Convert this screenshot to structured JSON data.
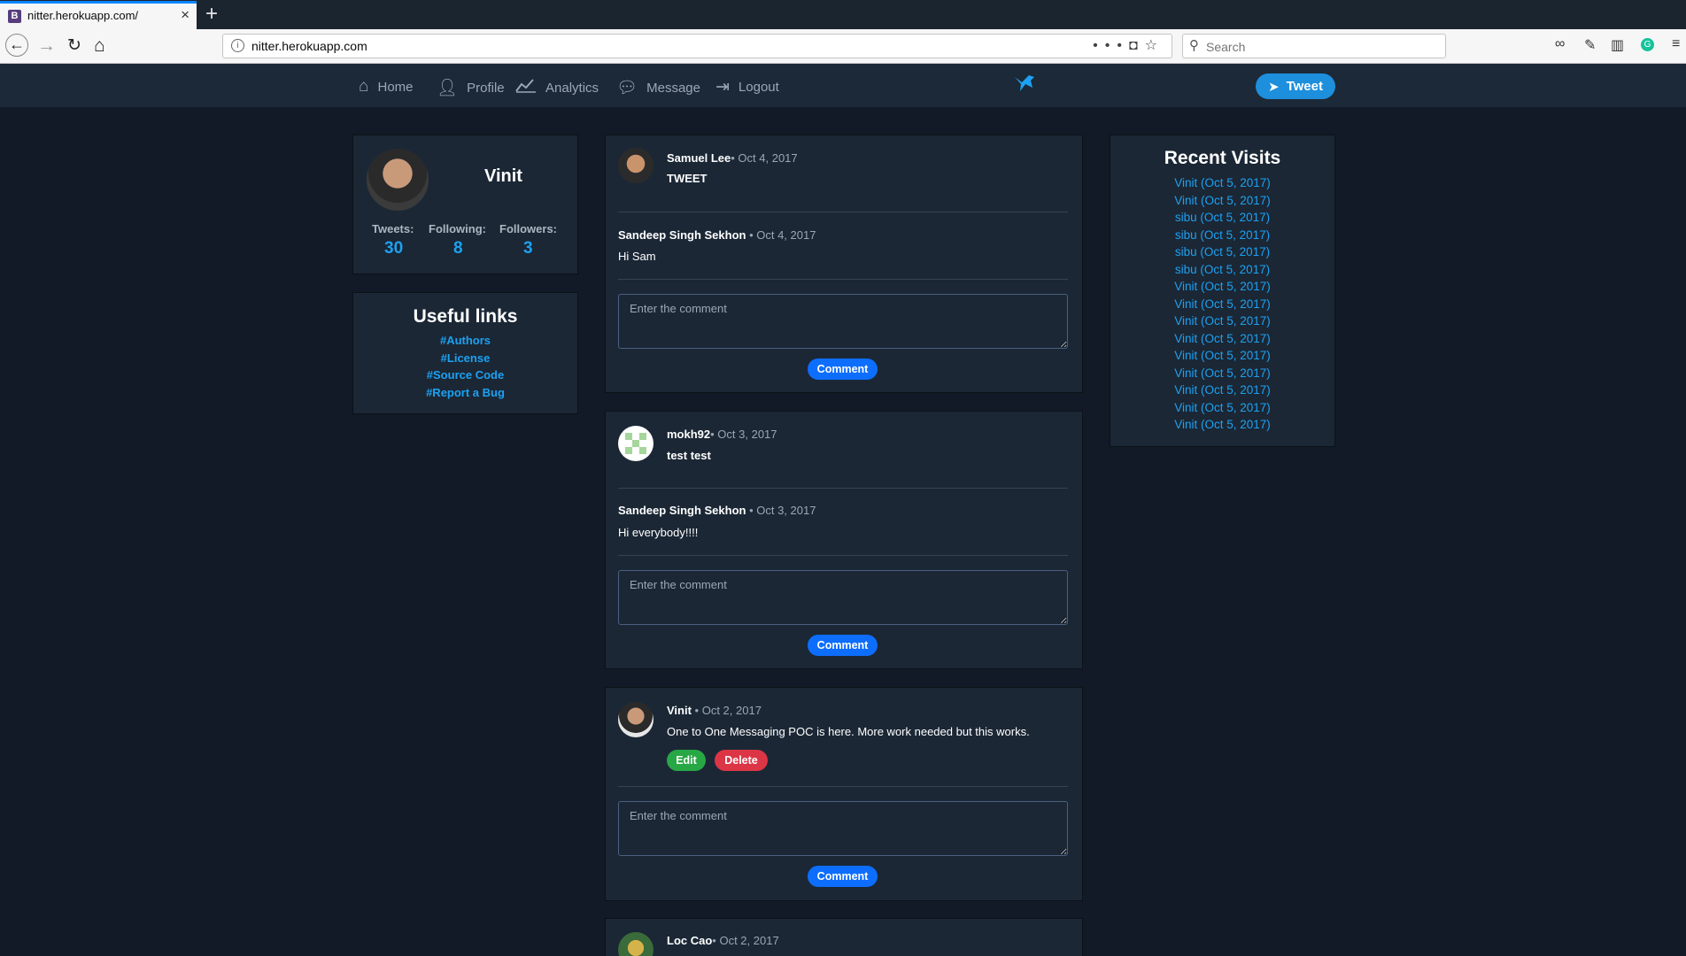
{
  "browser": {
    "tab_title": "nitter.herokuapp.com/",
    "tab_favicon": "B",
    "url": "nitter.herokuapp.com",
    "search_placeholder": "Search"
  },
  "nav": {
    "home": "Home",
    "profile": "Profile",
    "analytics": "Analytics",
    "message": "Message",
    "logout": "Logout",
    "tweet_button": "Tweet",
    "logo_icon": "bird-icon"
  },
  "profile": {
    "name": "Vinit",
    "tweets_label": "Tweets:",
    "tweets": "30",
    "following_label": "Following:",
    "following": "8",
    "followers_label": "Followers:",
    "followers": "3"
  },
  "useful_links": {
    "title": "Useful links",
    "links": [
      "#Authors",
      "#License",
      "#Source Code",
      "#Report a Bug"
    ]
  },
  "recent_visits": {
    "title": "Recent Visits",
    "items": [
      "Vinit (Oct 5, 2017)",
      "Vinit (Oct 5, 2017)",
      "sibu (Oct 5, 2017)",
      "sibu (Oct 5, 2017)",
      "sibu (Oct 5, 2017)",
      "sibu (Oct 5, 2017)",
      "Vinit (Oct 5, 2017)",
      "Vinit (Oct 5, 2017)",
      "Vinit (Oct 5, 2017)",
      "Vinit (Oct 5, 2017)",
      "Vinit (Oct 5, 2017)",
      "Vinit (Oct 5, 2017)",
      "Vinit (Oct 5, 2017)",
      "Vinit (Oct 5, 2017)",
      "Vinit (Oct 5, 2017)"
    ]
  },
  "feed": [
    {
      "author": "Samuel Lee",
      "date": "• Oct 4, 2017",
      "text": "TWEET",
      "comment_author": "Sandeep Singh Sekhon",
      "comment_date": " • Oct 4, 2017",
      "comment_text": "Hi Sam",
      "comment_placeholder": "Enter the comment",
      "comment_button": "Comment"
    },
    {
      "author": "mokh92",
      "date": "• Oct 3, 2017",
      "text": "test test",
      "comment_author": "Sandeep Singh Sekhon",
      "comment_date": " • Oct 3, 2017",
      "comment_text": "Hi everybody!!!!",
      "comment_placeholder": "Enter the comment",
      "comment_button": "Comment"
    },
    {
      "author": "Vinit",
      "date": " • Oct 2, 2017",
      "text": "One to One Messaging POC is here. More work needed but this works.",
      "edit_button": "Edit",
      "delete_button": "Delete",
      "comment_placeholder": "Enter the comment",
      "comment_button": "Comment"
    },
    {
      "author": "Loc Cao",
      "date": "• Oct 2, 2017"
    }
  ],
  "colors": {
    "background": "#111a26",
    "card": "#1b2735",
    "navbar": "#1c2938",
    "link": "#1da1f2",
    "comment_button": "#0d6efd",
    "edit_button": "#28a745",
    "delete_button": "#dc3545"
  }
}
